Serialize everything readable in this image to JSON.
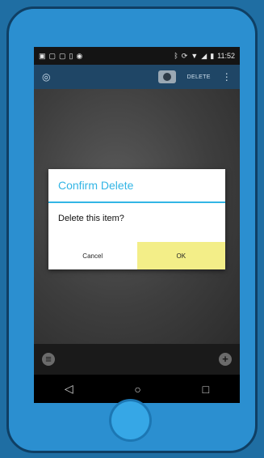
{
  "status_bar": {
    "time": "11:52",
    "left_icons": [
      "image-icon",
      "message-icon",
      "message-icon",
      "phone-icon",
      "android-icon"
    ],
    "right_icons": [
      "bluetooth-icon",
      "sync-icon",
      "wifi-icon",
      "signal-icon",
      "battery-icon"
    ]
  },
  "action_bar": {
    "delete_label": "DELETE"
  },
  "dialog": {
    "title": "Confirm Delete",
    "message": "Delete this item?",
    "cancel_label": "Cancel",
    "ok_label": "OK"
  },
  "colors": {
    "accent": "#33b5e5",
    "ok_button": "#f3ee88",
    "action_bar": "#1f4666"
  }
}
